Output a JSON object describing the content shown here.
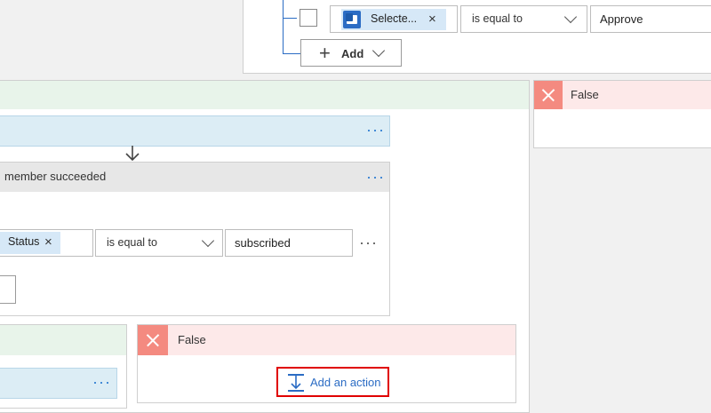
{
  "top_condition": {
    "token_label": "Selecte...",
    "token_remove": "×",
    "operator": "is equal to",
    "value": "Approve",
    "add_label": "Add",
    "add_plus": "+"
  },
  "right_false": {
    "label": "False"
  },
  "inner_scope": {
    "more": "···"
  },
  "condition_card": {
    "title": "member succeeded",
    "more": "···",
    "token_label": "Status",
    "token_remove": "×",
    "operator": "is equal to",
    "value": "subscribed",
    "row_more": "···"
  },
  "bottom_left": {
    "more": "···"
  },
  "bottom_false": {
    "label": "False",
    "add_action": "Add an action"
  },
  "colors": {
    "true_bg": "#e8f4ea",
    "false_bg": "#fde9e9",
    "false_icon": "#f48a80",
    "action_bg": "#dcedf5",
    "header_gray": "#e7e7e7",
    "accent": "#2b6cc4",
    "highlight_border": "#e00000"
  }
}
